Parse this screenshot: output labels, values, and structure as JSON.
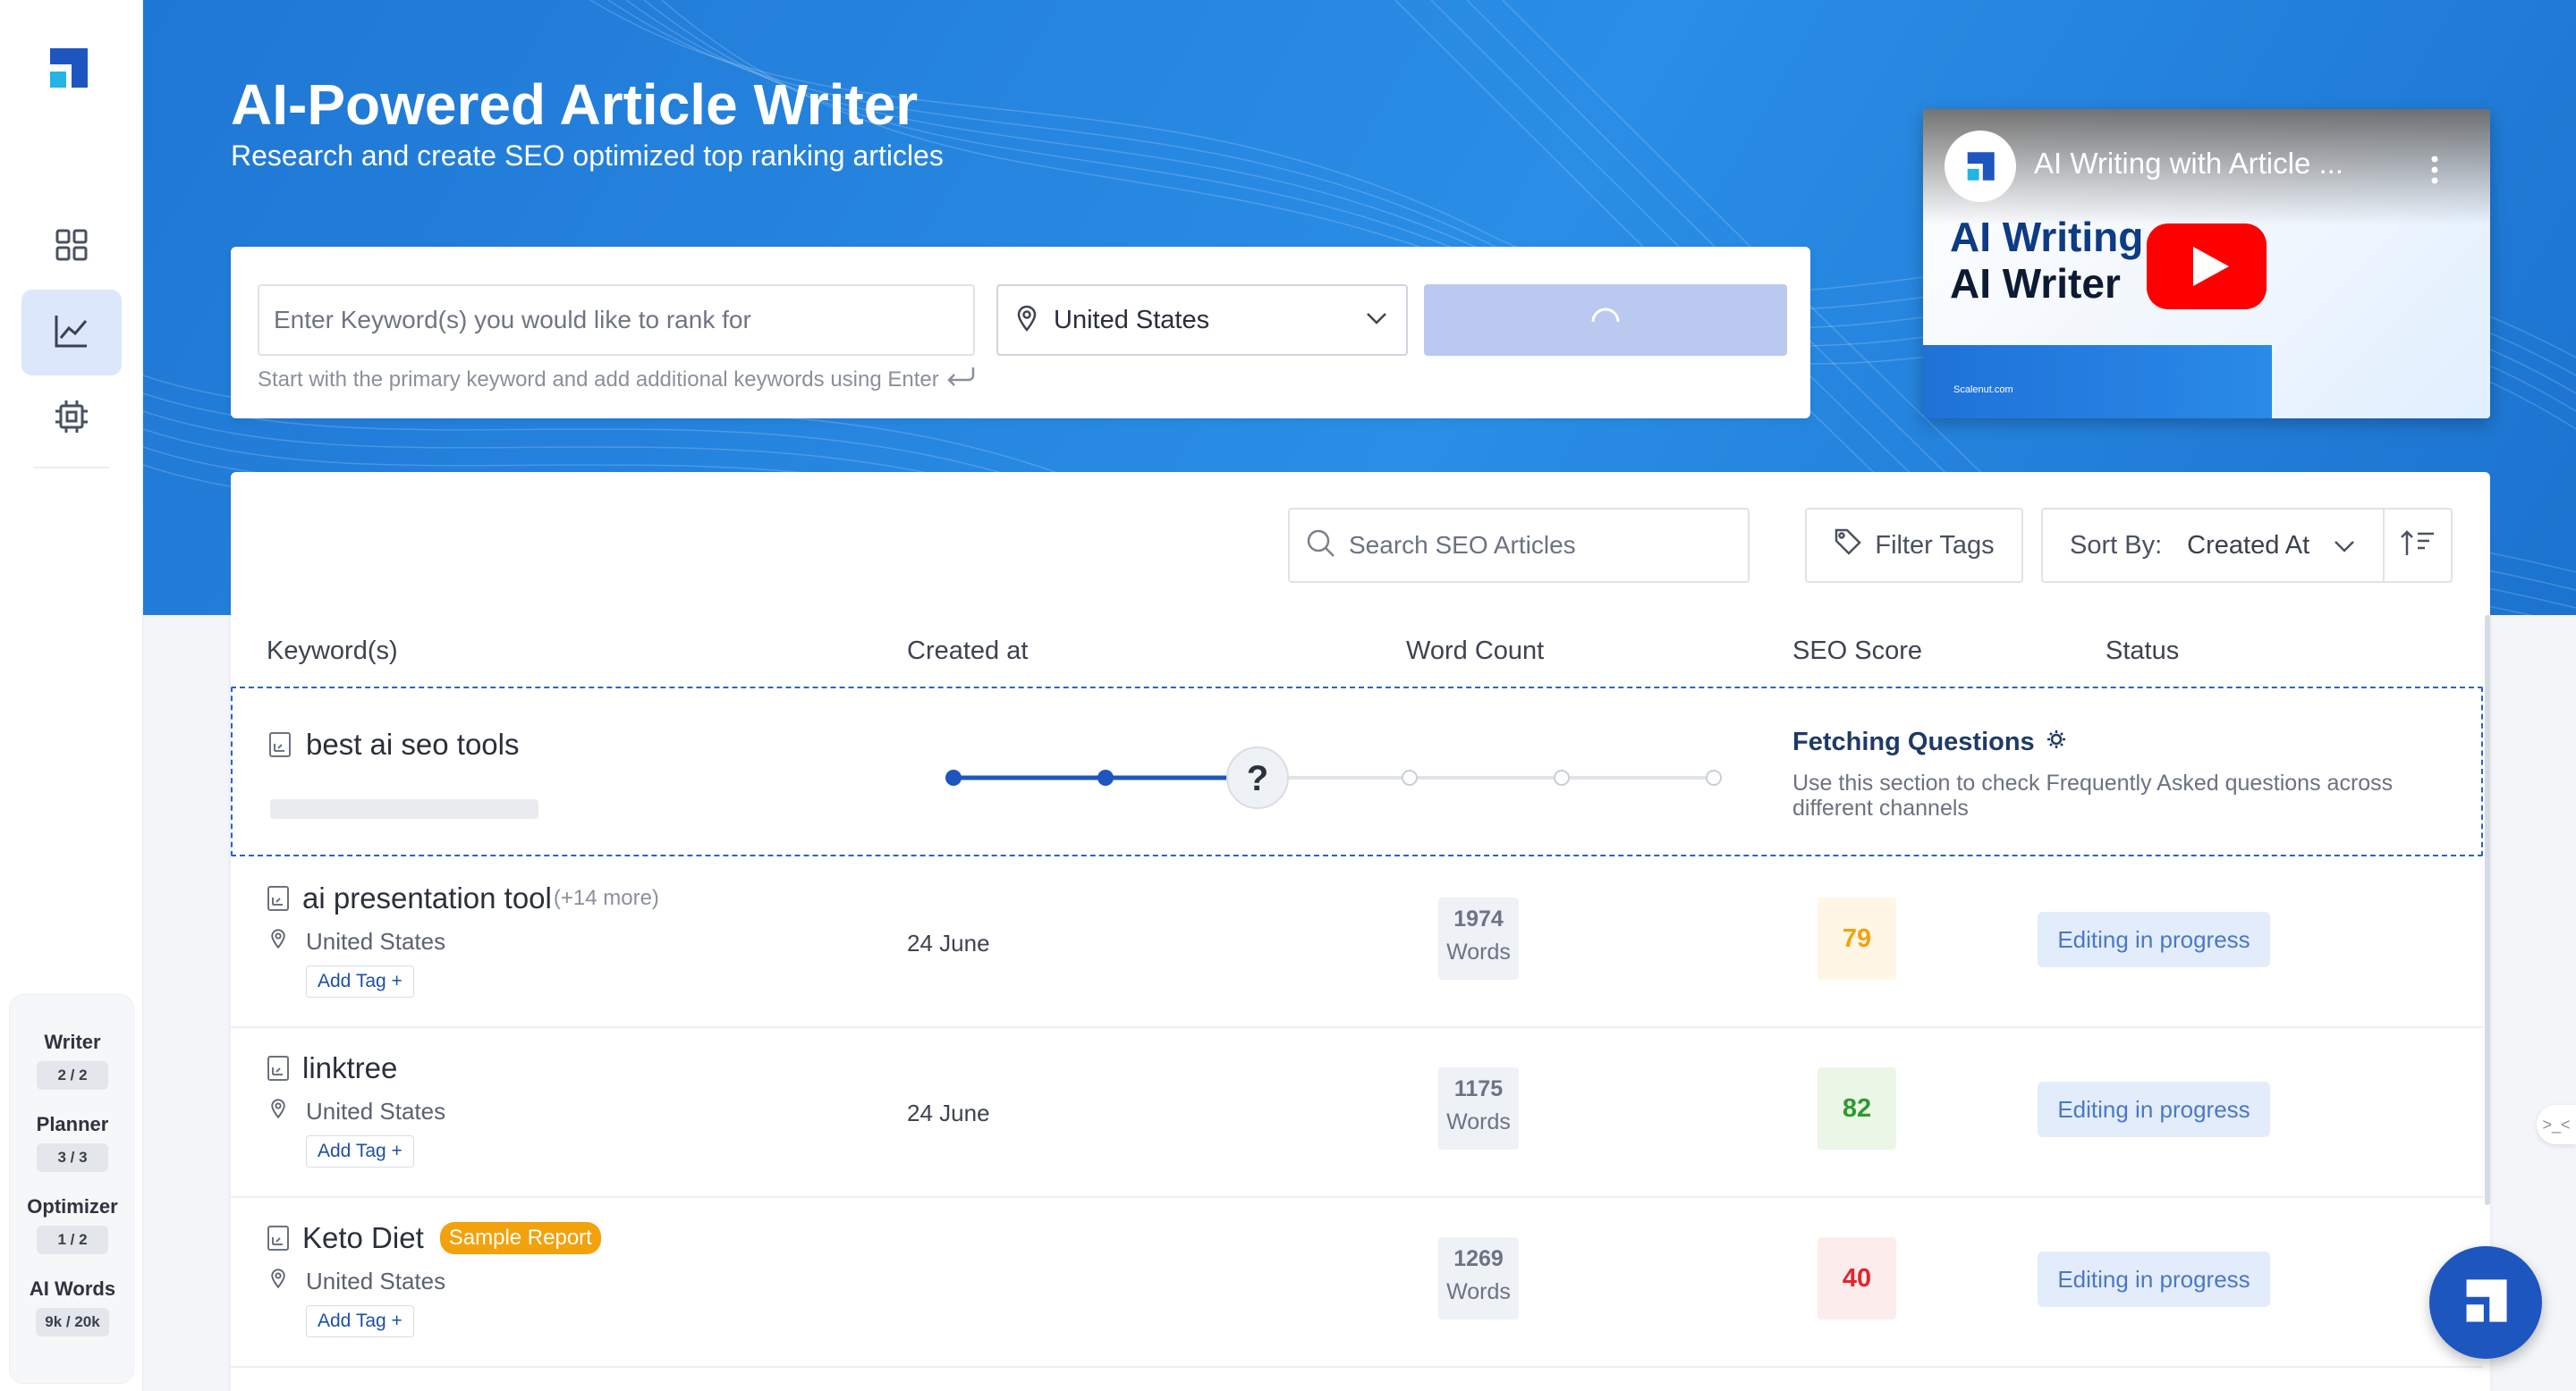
{
  "sidebar": {
    "usage": [
      {
        "label": "Writer",
        "value": "2 / 2"
      },
      {
        "label": "Planner",
        "value": "3 / 3"
      },
      {
        "label": "Optimizer",
        "value": "1 / 2"
      },
      {
        "label": "AI Words",
        "value": "9k / 20k"
      }
    ]
  },
  "hero": {
    "title": "AI-Powered Article Writer",
    "subtitle": "Research and create SEO optimized top ranking articles"
  },
  "search": {
    "keyword_placeholder": "Enter Keyword(s) you would like to rank for",
    "country": "United States",
    "hint": "Start with the primary keyword and add additional keywords using Enter"
  },
  "video": {
    "title": "AI Writing with Article ...",
    "line1": "AI Writing",
    "line2": "AI Writer",
    "site": "Scalenut.com"
  },
  "toolbar": {
    "search_placeholder": "Search SEO Articles",
    "filter_label": "Filter Tags",
    "sort_label": "Sort By:",
    "sort_value": "Created At"
  },
  "table": {
    "headers": [
      "Keyword(s)",
      "Created at",
      "Word Count",
      "SEO Score",
      "Status"
    ],
    "processing": {
      "keyword": "best ai seo tools",
      "step_current": 3,
      "step_total": 6,
      "step_title": "Fetching Questions",
      "step_desc": "Use this section to check Frequently Asked questions across different channels"
    },
    "rows": [
      {
        "keyword": "ai presentation tool",
        "more": "(+14 more)",
        "badge": "",
        "country": "United States",
        "add_tag": "Add Tag +",
        "date": "24 June",
        "words": "1974",
        "words_label": "Words",
        "score": "79",
        "status": "Editing in progress"
      },
      {
        "keyword": "linktree",
        "more": "",
        "badge": "",
        "country": "United States",
        "add_tag": "Add Tag +",
        "date": "24 June",
        "words": "1175",
        "words_label": "Words",
        "score": "82",
        "status": "Editing in progress"
      },
      {
        "keyword": "Keto Diet",
        "more": "",
        "badge": "Sample Report",
        "country": "United States",
        "add_tag": "Add Tag +",
        "date": "",
        "words": "1269",
        "words_label": "Words",
        "score": "40",
        "status": "Editing in progress"
      }
    ]
  },
  "colors": {
    "accent": "#1e56c0",
    "hero_bg": "#2a8ee6",
    "score_orange": "#f2a20c",
    "score_green": "#2e9a2e",
    "score_red": "#e0262d"
  },
  "misc": {
    "edge_widget": ">_<"
  }
}
